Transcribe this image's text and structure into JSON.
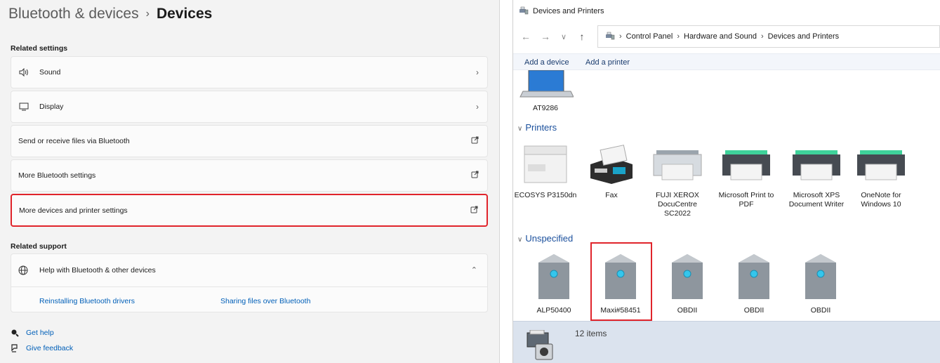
{
  "settings": {
    "breadcrumb_parent": "Bluetooth & devices",
    "breadcrumb_sep": "›",
    "breadcrumb_current": "Devices",
    "related_settings_heading": "Related settings",
    "items": [
      {
        "label": "Sound",
        "icon": "speaker-icon",
        "trail": "›"
      },
      {
        "label": "Display",
        "icon": "monitor-icon",
        "trail": "›"
      },
      {
        "label": "Send or receive files via Bluetooth",
        "trail": "external-link-icon"
      },
      {
        "label": "More Bluetooth settings",
        "trail": "external-link-icon"
      },
      {
        "label": "More devices and printer settings",
        "trail": "external-link-icon"
      }
    ],
    "related_support_heading": "Related support",
    "help_label": "Help with Bluetooth & other devices",
    "help_chevron": "⌃",
    "support_links": [
      "Reinstalling Bluetooth drivers",
      "Sharing files over Bluetooth"
    ],
    "get_help": "Get help",
    "give_feedback": "Give feedback",
    "highlight_color": "#e0242b",
    "link_color": "#005fb8"
  },
  "devices": {
    "window_title": "Devices and Printers",
    "nav": {
      "back": "←",
      "forward": "→",
      "recent": "∨",
      "up": "↑"
    },
    "address": [
      "Control Panel",
      "Hardware and Sound",
      "Devices and Printers"
    ],
    "address_sep": "›",
    "commands": [
      "Add a device",
      "Add a printer"
    ],
    "top_device": "AT9286",
    "printers_heading": "Printers",
    "printers": [
      "ECOSYS P3150dn",
      "Fax",
      "FUJI XEROX DocuCentre SC2022",
      "Microsoft Print to PDF",
      "Microsoft XPS Document Writer",
      "OneNote for Windows 10"
    ],
    "unspecified_heading": "Unspecified",
    "unspecified": [
      "ALP50400",
      "Maxi#58451",
      "OBDII",
      "OBDII",
      "OBDII"
    ],
    "status_count": "12 items",
    "group_chevron": "∨"
  }
}
